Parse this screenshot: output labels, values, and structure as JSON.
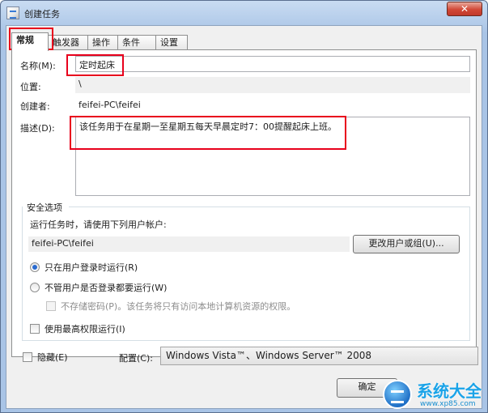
{
  "window": {
    "title": "创建任务",
    "close_label": "✕"
  },
  "tabs": [
    {
      "label": "常规"
    },
    {
      "label": "触发器"
    },
    {
      "label": "操作"
    },
    {
      "label": "条件"
    },
    {
      "label": "设置"
    }
  ],
  "general": {
    "name_label": "名称(M):",
    "name_value": "定时起床",
    "location_label": "位置:",
    "location_value": "\\",
    "author_label": "创建者:",
    "author_value": "feifei-PC\\feifei",
    "description_label": "描述(D):",
    "description_value": "该任务用于在星期一至星期五每天早晨定时7：00提醒起床上班。"
  },
  "security": {
    "group_title": "安全选项",
    "run_as_label": "运行任务时，请使用下列用户帐户:",
    "user_account": "feifei-PC\\feifei",
    "change_user_button": "更改用户或组(U)...",
    "radio_logged_on": "只在用户登录时运行(R)",
    "radio_whether_logged": "不管用户是否登录都要运行(W)",
    "no_store_password": "不存储密码(P)。该任务将只有访问本地计算机资源的权限。",
    "highest_privileges": "使用最高权限运行(I)",
    "selected_option": "radio_logged_on"
  },
  "footer": {
    "hidden_label": "隐藏(E)",
    "configure_label": "配置(C):",
    "configure_value": "Windows Vista™、Windows Server™ 2008",
    "ok_button": "确定"
  },
  "watermark": {
    "title": "系统大全",
    "url": "www.xp85.com"
  },
  "colors": {
    "highlight_red": "#e8001c",
    "radio_selected": "#2a6bd0",
    "watermark_blue": "#1aa3e8"
  }
}
